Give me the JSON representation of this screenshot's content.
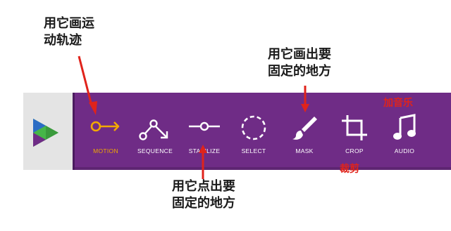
{
  "annotations": {
    "motion": [
      "用它画运",
      "动轨迹"
    ],
    "mask": [
      "用它画出要",
      "固定的地方"
    ],
    "stabilize": [
      "用它点出要",
      "固定的地方"
    ],
    "audio": "加音乐",
    "crop": "裁剪"
  },
  "toolbar": {
    "tools": [
      {
        "label": "MOTION",
        "icon": "motion-key-icon",
        "active": true
      },
      {
        "label": "SEQUENCE",
        "icon": "sequence-nodes-icon",
        "active": false
      },
      {
        "label": "STABILIZE",
        "icon": "stabilize-slider-icon",
        "active": false
      },
      {
        "label": "SELECT",
        "icon": "select-dashed-circle-icon",
        "active": false
      },
      {
        "label": "MASK",
        "icon": "mask-brush-icon",
        "active": false
      },
      {
        "label": "CROP",
        "icon": "crop-icon",
        "active": false
      },
      {
        "label": "AUDIO",
        "icon": "audio-note-icon",
        "active": false
      }
    ]
  },
  "colors": {
    "toolbar_bg": "#6f2c86",
    "active_accent": "#f2a900",
    "annotation_red": "#e0231b",
    "logo_green": "#46b648",
    "logo_blue": "#2b6cc4",
    "logo_purple": "#6f2c86"
  }
}
